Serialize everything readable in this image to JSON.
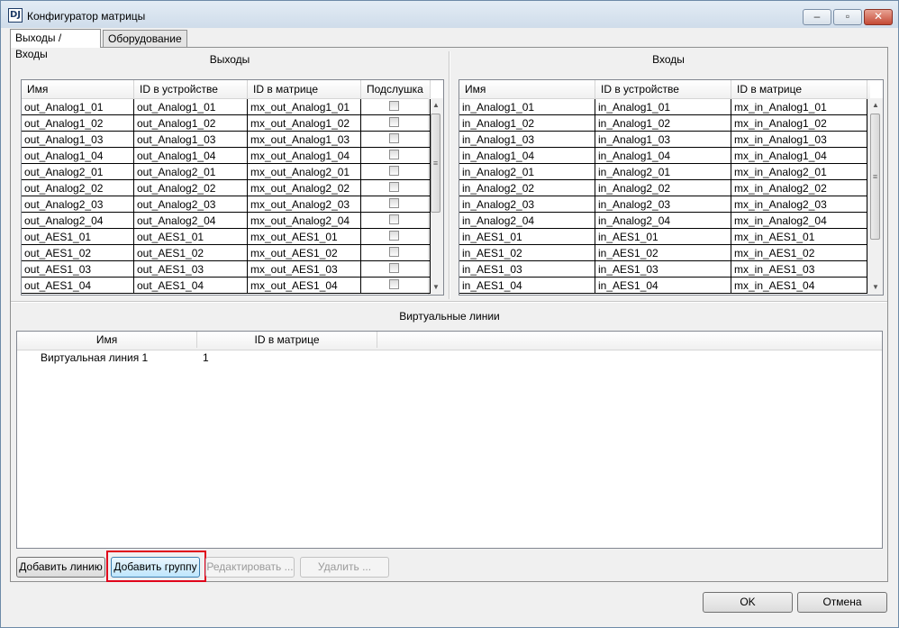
{
  "window": {
    "title": "Конфигуратор матрицы",
    "app_icon": "DJ"
  },
  "tabs": [
    {
      "label": "Выходы / Входы",
      "active": true
    },
    {
      "label": "Оборудование",
      "active": false
    }
  ],
  "outputs": {
    "section_title": "Выходы",
    "columns": [
      "Имя",
      "ID в устройстве",
      "ID в матрице",
      "Подслушка"
    ],
    "rows": [
      [
        "out_Analog1_01",
        "out_Analog1_01",
        "mx_out_Analog1_01"
      ],
      [
        "out_Analog1_02",
        "out_Analog1_02",
        "mx_out_Analog1_02"
      ],
      [
        "out_Analog1_03",
        "out_Analog1_03",
        "mx_out_Analog1_03"
      ],
      [
        "out_Analog1_04",
        "out_Analog1_04",
        "mx_out_Analog1_04"
      ],
      [
        "out_Analog2_01",
        "out_Analog2_01",
        "mx_out_Analog2_01"
      ],
      [
        "out_Analog2_02",
        "out_Analog2_02",
        "mx_out_Analog2_02"
      ],
      [
        "out_Analog2_03",
        "out_Analog2_03",
        "mx_out_Analog2_03"
      ],
      [
        "out_Analog2_04",
        "out_Analog2_04",
        "mx_out_Analog2_04"
      ],
      [
        "out_AES1_01",
        "out_AES1_01",
        "mx_out_AES1_01"
      ],
      [
        "out_AES1_02",
        "out_AES1_02",
        "mx_out_AES1_02"
      ],
      [
        "out_AES1_03",
        "out_AES1_03",
        "mx_out_AES1_03"
      ],
      [
        "out_AES1_04",
        "out_AES1_04",
        "mx_out_AES1_04"
      ]
    ]
  },
  "inputs": {
    "section_title": "Входы",
    "columns": [
      "Имя",
      "ID в устройстве",
      "ID в матрице"
    ],
    "rows": [
      [
        "in_Analog1_01",
        "in_Analog1_01",
        "mx_in_Analog1_01"
      ],
      [
        "in_Analog1_02",
        "in_Analog1_02",
        "mx_in_Analog1_02"
      ],
      [
        "in_Analog1_03",
        "in_Analog1_03",
        "mx_in_Analog1_03"
      ],
      [
        "in_Analog1_04",
        "in_Analog1_04",
        "mx_in_Analog1_04"
      ],
      [
        "in_Analog2_01",
        "in_Analog2_01",
        "mx_in_Analog2_01"
      ],
      [
        "in_Analog2_02",
        "in_Analog2_02",
        "mx_in_Analog2_02"
      ],
      [
        "in_Analog2_03",
        "in_Analog2_03",
        "mx_in_Analog2_03"
      ],
      [
        "in_Analog2_04",
        "in_Analog2_04",
        "mx_in_Analog2_04"
      ],
      [
        "in_AES1_01",
        "in_AES1_01",
        "mx_in_AES1_01"
      ],
      [
        "in_AES1_02",
        "in_AES1_02",
        "mx_in_AES1_02"
      ],
      [
        "in_AES1_03",
        "in_AES1_03",
        "mx_in_AES1_03"
      ],
      [
        "in_AES1_04",
        "in_AES1_04",
        "mx_in_AES1_04"
      ]
    ]
  },
  "virtual_lines": {
    "section_title": "Виртуальные линии",
    "columns": [
      "Имя",
      "ID в матрице"
    ],
    "rows": [
      [
        "Виртуальная линия 1",
        "1"
      ]
    ]
  },
  "actions": {
    "add_line": "Добавить линию",
    "add_group": "Добавить группу",
    "edit": "Редактировать ...",
    "delete": "Удалить ..."
  },
  "dialog": {
    "ok": "OK",
    "cancel": "Отмена"
  },
  "colors": {
    "highlight": "#e0001b",
    "focus_button": "#bee6fd"
  }
}
